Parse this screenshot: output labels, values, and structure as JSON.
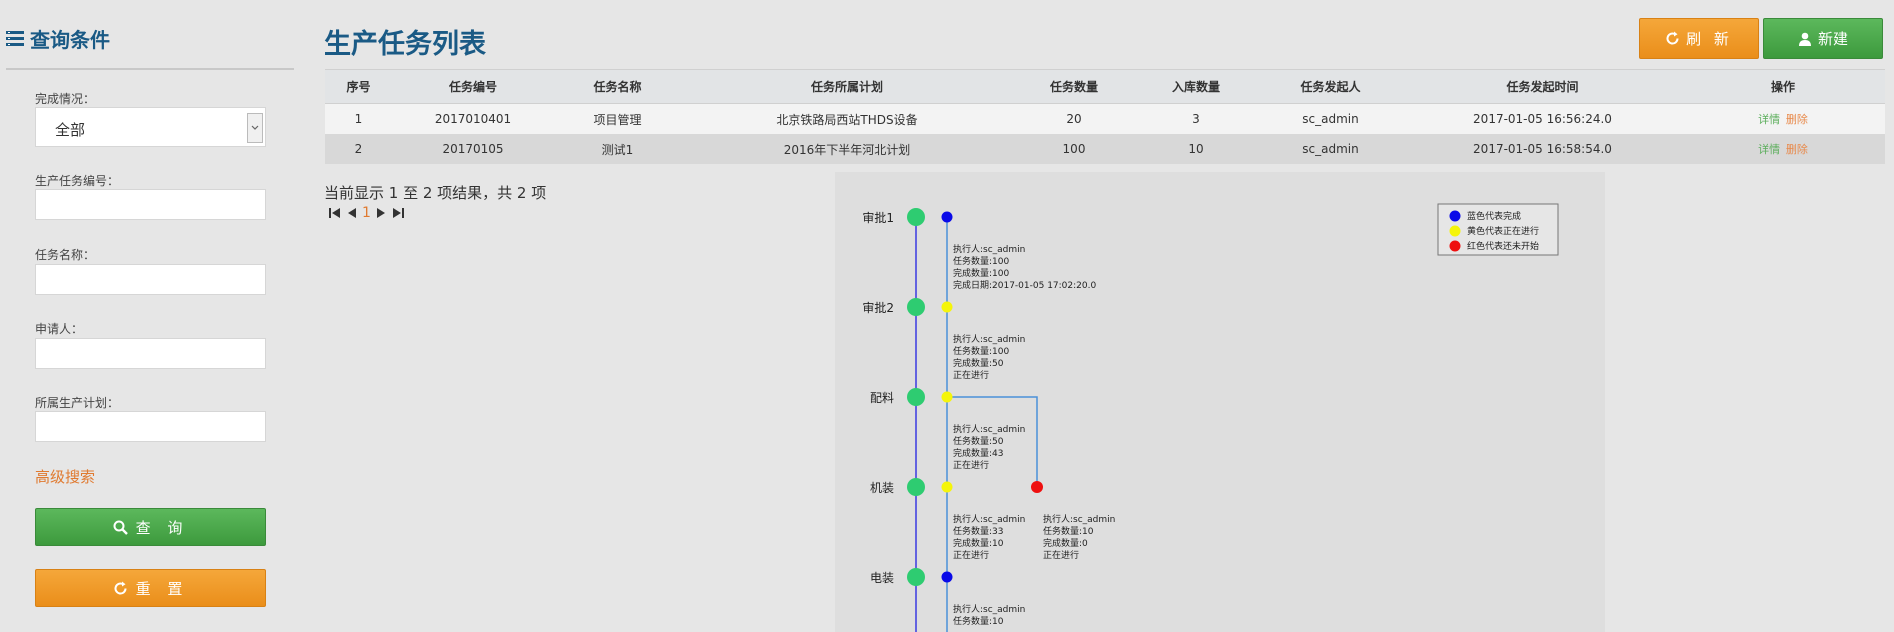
{
  "sidebar": {
    "title": "查询条件",
    "status_label": "完成情况：",
    "status_value": "全部",
    "task_no_label": "生产任务编号：",
    "task_name_label": "任务名称：",
    "applicant_label": "申请人：",
    "plan_label": "所属生产计划：",
    "advanced_link": "高级搜索",
    "query_button": "查 询",
    "reset_button": "重 置"
  },
  "header": {
    "title": "生产任务列表",
    "refresh_button": "刷 新",
    "new_button": "新建"
  },
  "table": {
    "columns": [
      "序号",
      "任务编号",
      "任务名称",
      "任务所属计划",
      "任务数量",
      "入库数量",
      "任务发起人",
      "任务发起时间",
      "操作"
    ],
    "rows": [
      {
        "no": "1",
        "code": "2017010401",
        "name": "项目管理",
        "plan": "北京铁路局西站THDS设备",
        "qty": "20",
        "stored": "3",
        "initiator": "sc_admin",
        "time": "2017-01-05 16:56:24.0",
        "detail": "详情",
        "delete": "删除"
      },
      {
        "no": "2",
        "code": "20170105",
        "name": "测试1",
        "plan": "2016年下半年河北计划",
        "qty": "100",
        "stored": "10",
        "initiator": "sc_admin",
        "time": "2017-01-05 16:58:54.0",
        "detail": "详情",
        "delete": "删除"
      }
    ]
  },
  "pagination": {
    "info": "当前显示 1 至 2 项结果，共 2 项",
    "current": "1"
  },
  "flow": {
    "legend": [
      {
        "label": "蓝色代表完成",
        "color": "#0a0ae8"
      },
      {
        "label": "黄色代表正在进行",
        "color": "#f5f50a"
      },
      {
        "label": "红色代表还未开始",
        "color": "#ee1010"
      }
    ],
    "steps": [
      {
        "label": "审批1",
        "status_color": "#0a0ae8",
        "info": [
          "执行人:sc_admin",
          "任务数量:100",
          "完成数量:100",
          "完成日期:2017-01-05 17:02:20.0"
        ]
      },
      {
        "label": "审批2",
        "status_color": "#f5f50a",
        "info": [
          "执行人:sc_admin",
          "任务数量:100",
          "完成数量:50",
          "正在进行"
        ]
      },
      {
        "label": "配料",
        "status_color": "#f5f50a",
        "info": [
          "执行人:sc_admin",
          "任务数量:50",
          "完成数量:43",
          "正在进行"
        ]
      },
      {
        "label": "机装",
        "status_color": "#f5f50a",
        "info": [
          "执行人:sc_admin",
          "任务数量:33",
          "完成数量:10",
          "正在进行"
        ]
      },
      {
        "label": "电装",
        "status_color": "#0a0ae8",
        "info": [
          "执行人:sc_admin",
          "任务数量:10"
        ]
      }
    ],
    "branch": {
      "status_color": "#ee1010",
      "info": [
        "执行人:sc_admin",
        "任务数量:10",
        "完成数量:0",
        "正在进行"
      ]
    },
    "node_color": "#2ecc71",
    "line_color": "#3a3ae0",
    "branch_line_color": "#4a90d9"
  }
}
